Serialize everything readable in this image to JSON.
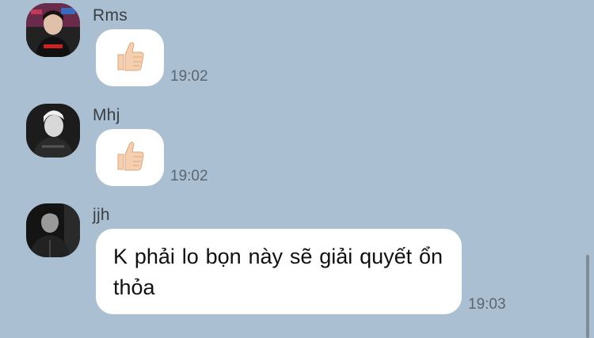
{
  "messages": [
    {
      "sender": "Rms",
      "content_type": "emoji",
      "emoji": "thumbs-up",
      "time": "19:02"
    },
    {
      "sender": "Mhj",
      "content_type": "emoji",
      "emoji": "thumbs-up",
      "time": "19:02"
    },
    {
      "sender": "jjh",
      "content_type": "text",
      "text": "K phải lo bọn này sẽ giải quyết ổn thỏa",
      "time": "19:03"
    }
  ],
  "colors": {
    "background": "#abbfd2",
    "bubble": "#ffffff",
    "timestamp": "#5b6670",
    "sender_name": "#3a3f44"
  }
}
